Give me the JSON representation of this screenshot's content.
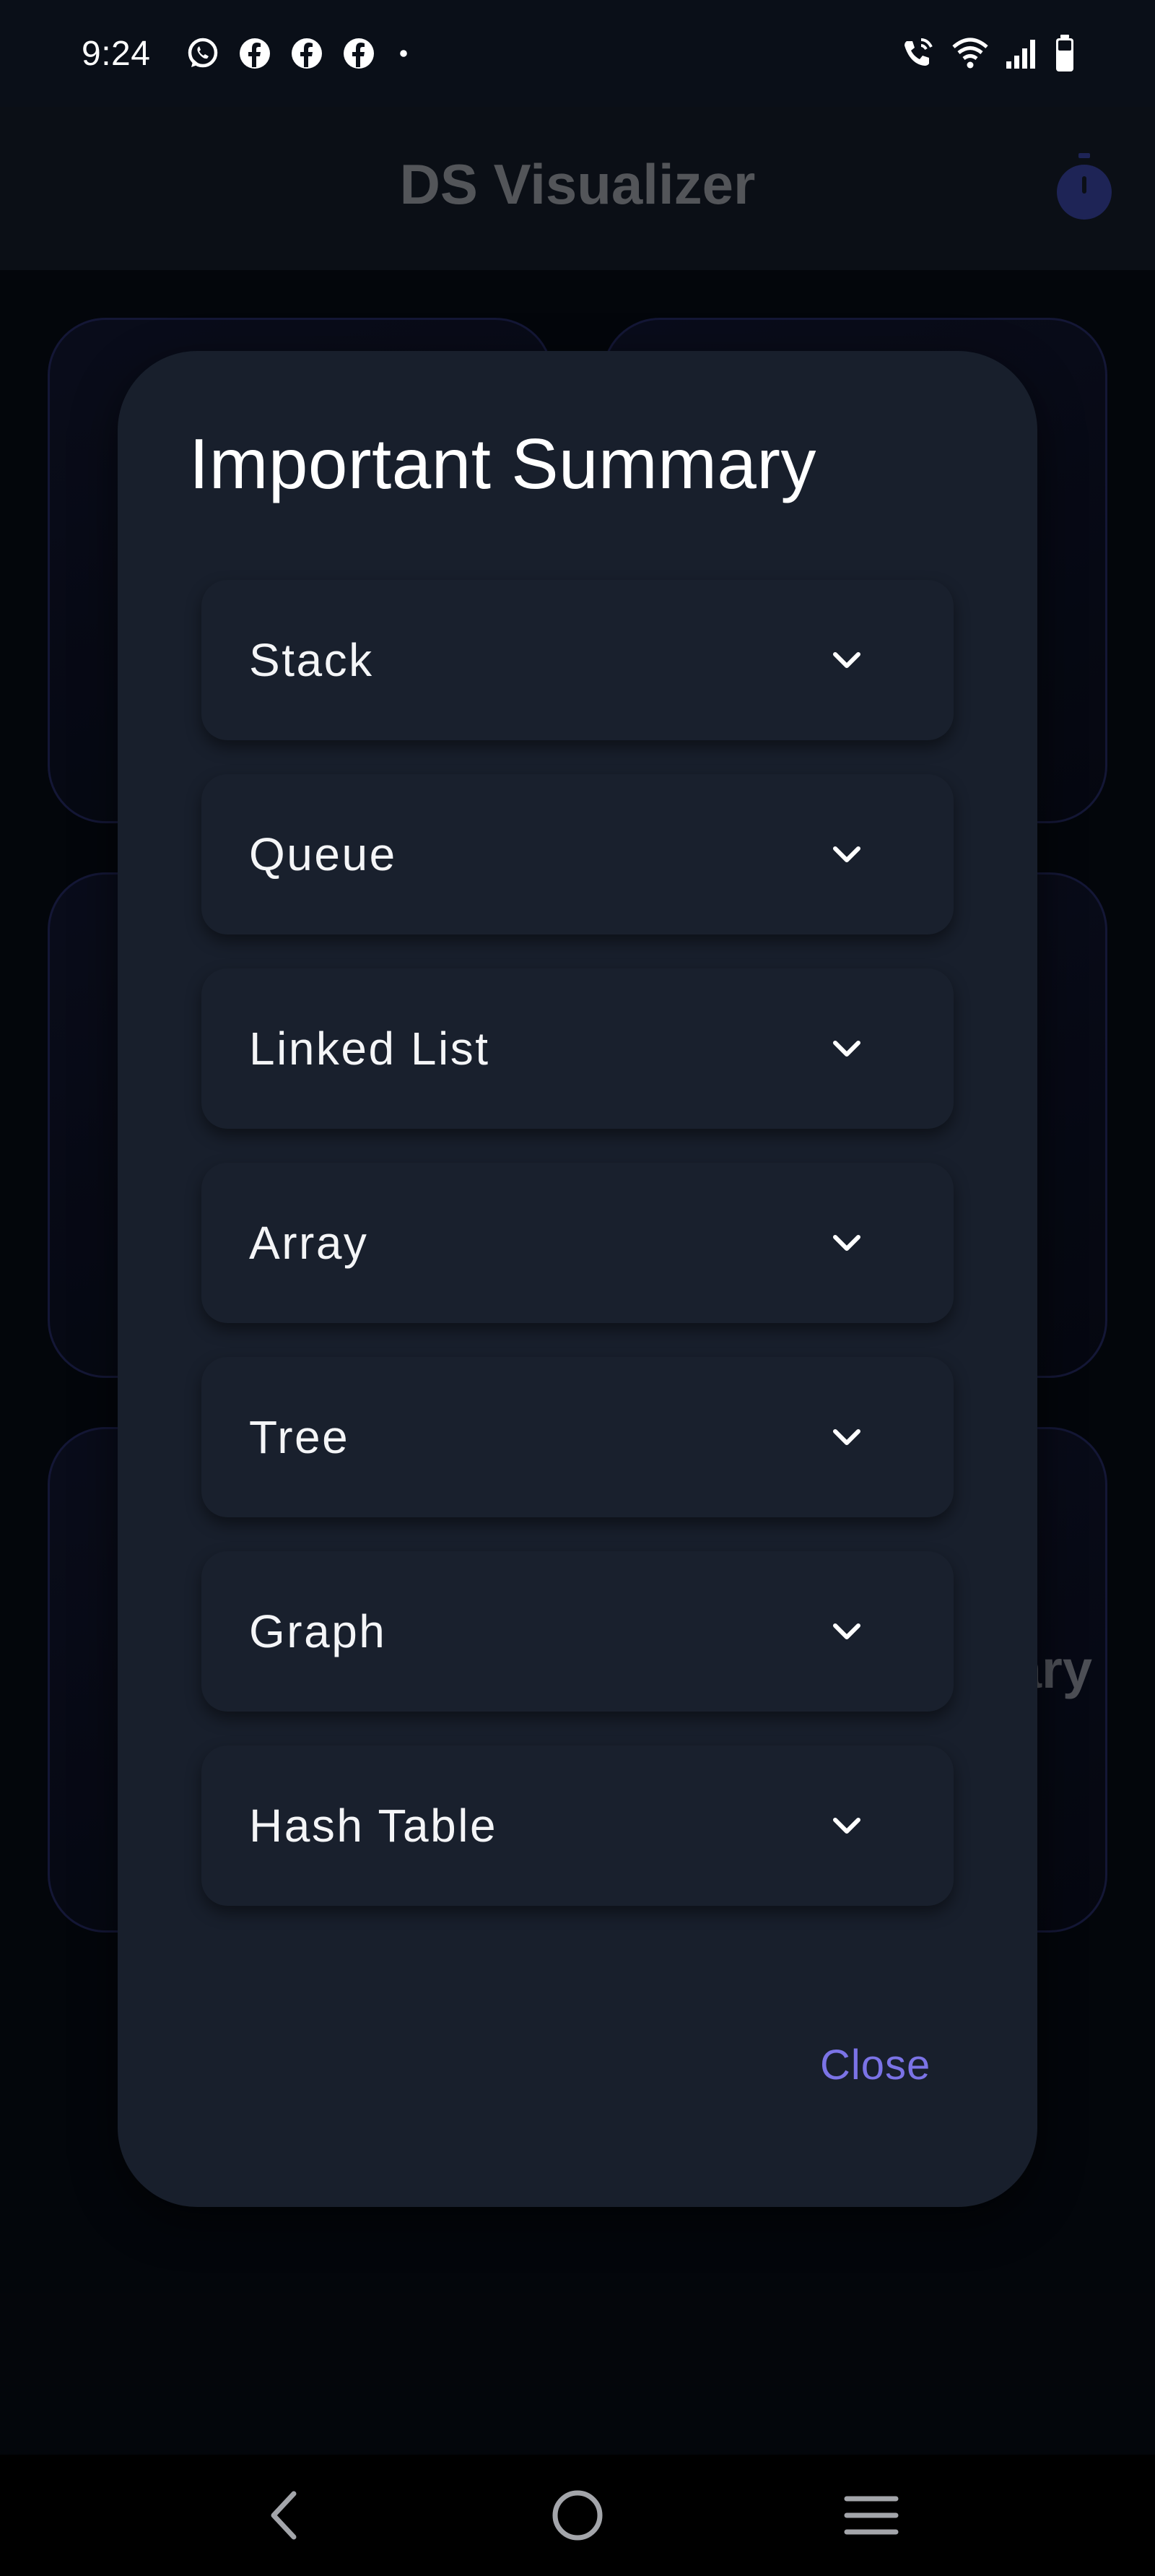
{
  "status_bar": {
    "time": "9:24",
    "notification_icons": [
      "whatsapp-icon",
      "facebook-icon",
      "facebook-icon",
      "facebook-icon",
      "dot-icon"
    ],
    "system_icons": [
      "wifi-calling-icon",
      "wifi-icon",
      "signal-icon",
      "battery-icon"
    ]
  },
  "app_bar": {
    "title": "DS Visualizer",
    "action_icon": "timer-icon"
  },
  "background": {
    "partial_label": "ary"
  },
  "dialog": {
    "title": "Important Summary",
    "items": [
      {
        "label": "Stack"
      },
      {
        "label": "Queue"
      },
      {
        "label": "Linked List"
      },
      {
        "label": "Array"
      },
      {
        "label": "Tree"
      },
      {
        "label": "Graph"
      },
      {
        "label": "Hash Table"
      }
    ],
    "close_label": "Close"
  },
  "nav_bar": {
    "icons": [
      "back-icon",
      "home-icon",
      "recents-icon"
    ]
  },
  "colors": {
    "dialog_bg": "#181f2c",
    "accent": "#7b73e6",
    "timer_icon": "#283073"
  }
}
